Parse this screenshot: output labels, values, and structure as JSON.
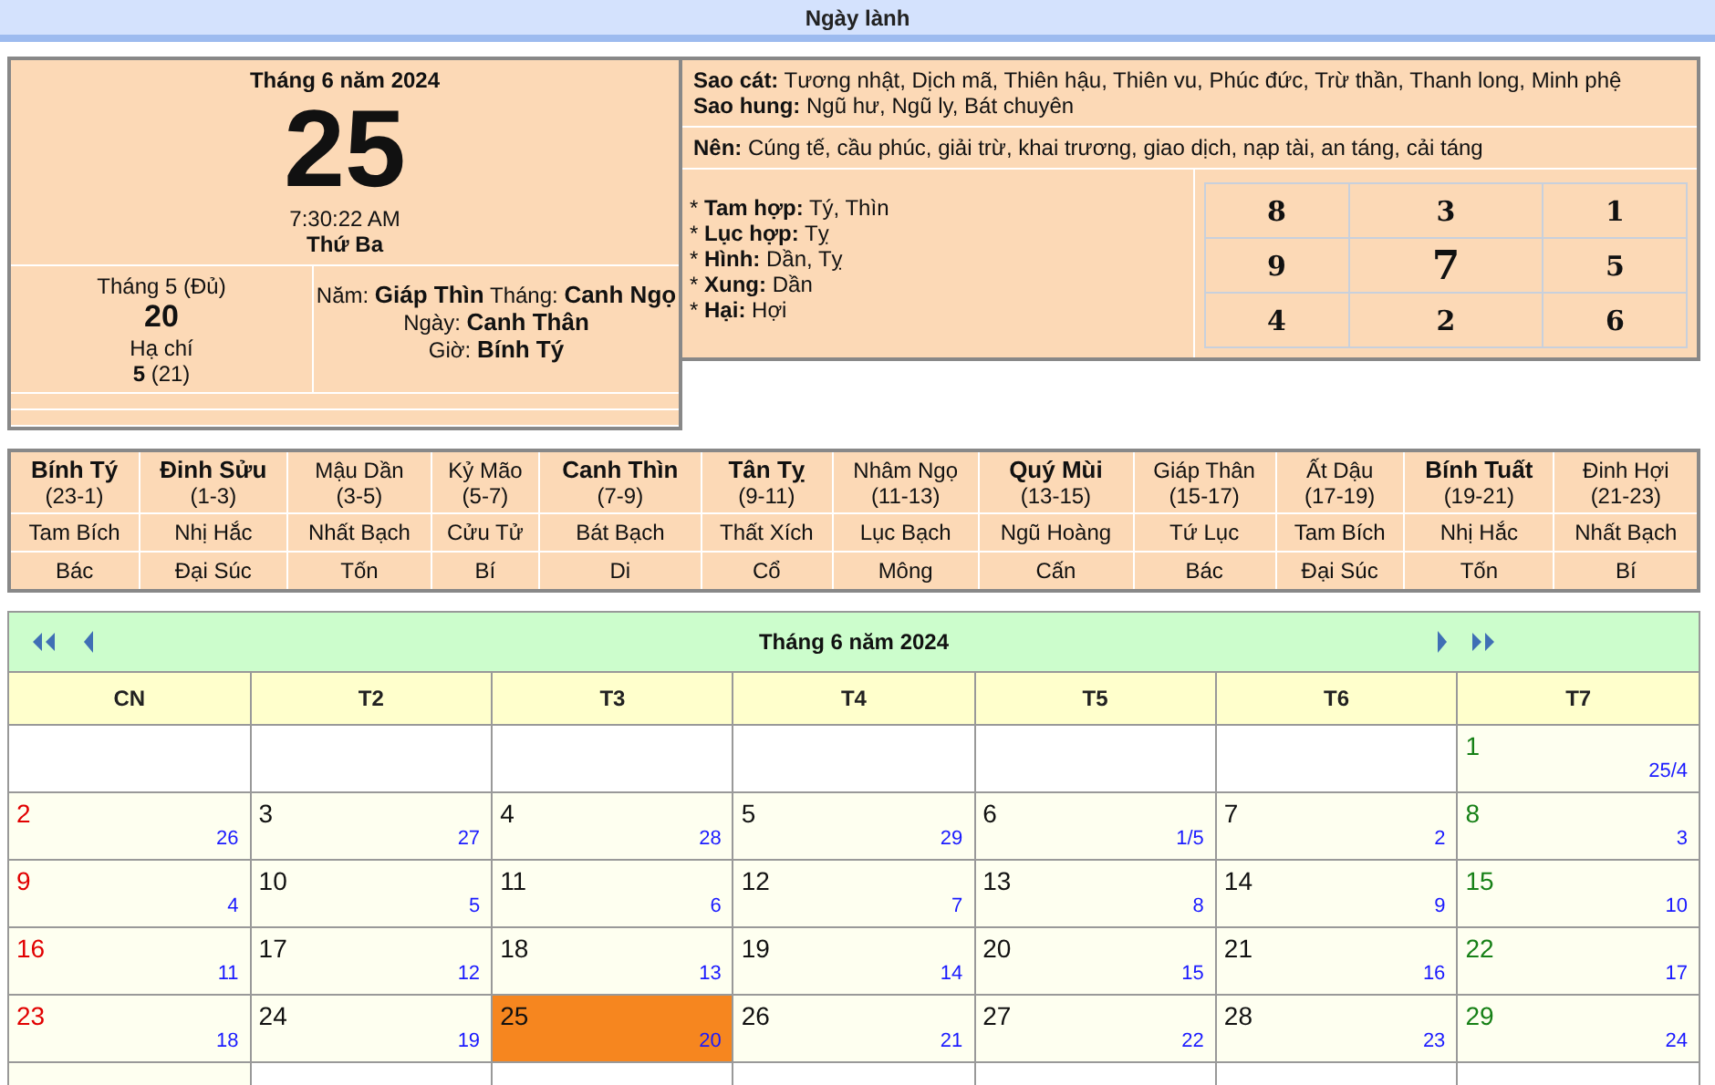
{
  "header": {
    "title": "Ngày lành"
  },
  "today": {
    "month_title": "Tháng 6 năm 2024",
    "day": "25",
    "time": "7:30:22 AM",
    "weekday": "Thứ Ba",
    "lunar": {
      "month": "Tháng 5 (Đủ)",
      "day": "20",
      "solar_term": "Hạ chí",
      "term_date": "**5** (21)"
    },
    "can_chi": [
      "Năm: **Giáp Thìn** Tháng: **Canh Ngọ**",
      "Ngày: **Canh Thân**",
      "Giờ: **Bính Tý**"
    ]
  },
  "info": {
    "stars": [
      "**Sao cát:** Tương nhật, Dịch mã, Thiên hậu, Thiên vu, Phúc đức, Trừ thần, Thanh long, Minh phệ",
      "**Sao hung:** Ngũ hư, Ngũ ly, Bát chuyên"
    ],
    "should": "**Nên:** Cúng tế, cầu phúc, giải trừ, khai trương, giao dịch, nạp tài, an táng, cải táng",
    "relations": [
      "* **Tam hợp:** Tý, Thìn",
      "* **Lục hợp:** Tỵ",
      "* **Hình:** Dần, Tỵ",
      "* **Xung:** Dần",
      "* **Hại:** Hợi"
    ],
    "grid": [
      [
        "8",
        "3",
        "1"
      ],
      [
        "9",
        "7",
        "5"
      ],
      [
        "4",
        "2",
        "6"
      ]
    ]
  },
  "hours": [
    {
      "name": "Bính Tý",
      "range": "(23-1)",
      "good": true,
      "star": "Tam Bích",
      "hexagram": "Bác"
    },
    {
      "name": "Đinh Sửu",
      "range": "(1-3)",
      "good": true,
      "star": "Nhị Hắc",
      "hexagram": "Đại Súc"
    },
    {
      "name": "Mậu Dần",
      "range": "(3-5)",
      "good": false,
      "star": "Nhất Bạch",
      "hexagram": "Tốn"
    },
    {
      "name": "Kỷ Mão",
      "range": "(5-7)",
      "good": false,
      "star": "Cửu Tử",
      "hexagram": "Bí"
    },
    {
      "name": "Canh Thìn",
      "range": "(7-9)",
      "good": true,
      "star": "Bát Bạch",
      "hexagram": "Di"
    },
    {
      "name": "Tân Tỵ",
      "range": "(9-11)",
      "good": true,
      "star": "Thất Xích",
      "hexagram": "Cổ"
    },
    {
      "name": "Nhâm Ngọ",
      "range": "(11-13)",
      "good": false,
      "star": "Lục Bạch",
      "hexagram": "Mông"
    },
    {
      "name": "Quý Mùi",
      "range": "(13-15)",
      "good": true,
      "star": "Ngũ Hoàng",
      "hexagram": "Cấn"
    },
    {
      "name": "Giáp Thân",
      "range": "(15-17)",
      "good": false,
      "star": "Tứ Lục",
      "hexagram": "Bác"
    },
    {
      "name": "Ất Dậu",
      "range": "(17-19)",
      "good": false,
      "star": "Tam Bích",
      "hexagram": "Đại Súc"
    },
    {
      "name": "Bính Tuất",
      "range": "(19-21)",
      "good": true,
      "star": "Nhị Hắc",
      "hexagram": "Tốn"
    },
    {
      "name": "Đinh Hợi",
      "range": "(21-23)",
      "good": false,
      "star": "Nhất Bạch",
      "hexagram": "Bí"
    }
  ],
  "calendar": {
    "title": "Tháng 6 năm 2024",
    "weekdays": [
      "CN",
      "T2",
      "T3",
      "T4",
      "T5",
      "T6",
      "T7"
    ],
    "weeks": [
      [
        {
          "kind": "blank"
        },
        {
          "kind": "blank"
        },
        {
          "kind": "blank"
        },
        {
          "kind": "blank"
        },
        {
          "kind": "blank"
        },
        {
          "kind": "blank"
        },
        {
          "kind": "day",
          "day": "1",
          "lunar": "25/4",
          "selected": false
        }
      ],
      [
        {
          "kind": "day",
          "day": "2",
          "lunar": "26",
          "selected": false
        },
        {
          "kind": "day",
          "day": "3",
          "lunar": "27",
          "selected": false
        },
        {
          "kind": "day",
          "day": "4",
          "lunar": "28",
          "selected": false
        },
        {
          "kind": "day",
          "day": "5",
          "lunar": "29",
          "selected": false
        },
        {
          "kind": "day",
          "day": "6",
          "lunar": "1/5",
          "selected": false
        },
        {
          "kind": "day",
          "day": "7",
          "lunar": "2",
          "selected": false
        },
        {
          "kind": "day",
          "day": "8",
          "lunar": "3",
          "selected": false
        }
      ],
      [
        {
          "kind": "day",
          "day": "9",
          "lunar": "4",
          "selected": false
        },
        {
          "kind": "day",
          "day": "10",
          "lunar": "5",
          "selected": false
        },
        {
          "kind": "day",
          "day": "11",
          "lunar": "6",
          "selected": false
        },
        {
          "kind": "day",
          "day": "12",
          "lunar": "7",
          "selected": false
        },
        {
          "kind": "day",
          "day": "13",
          "lunar": "8",
          "selected": false
        },
        {
          "kind": "day",
          "day": "14",
          "lunar": "9",
          "selected": false
        },
        {
          "kind": "day",
          "day": "15",
          "lunar": "10",
          "selected": false
        }
      ],
      [
        {
          "kind": "day",
          "day": "16",
          "lunar": "11",
          "selected": false
        },
        {
          "kind": "day",
          "day": "17",
          "lunar": "12",
          "selected": false
        },
        {
          "kind": "day",
          "day": "18",
          "lunar": "13",
          "selected": false
        },
        {
          "kind": "day",
          "day": "19",
          "lunar": "14",
          "selected": false
        },
        {
          "kind": "day",
          "day": "20",
          "lunar": "15",
          "selected": false
        },
        {
          "kind": "day",
          "day": "21",
          "lunar": "16",
          "selected": false
        },
        {
          "kind": "day",
          "day": "22",
          "lunar": "17",
          "selected": false
        }
      ],
      [
        {
          "kind": "day",
          "day": "23",
          "lunar": "18",
          "selected": false
        },
        {
          "kind": "day",
          "day": "24",
          "lunar": "19",
          "selected": false
        },
        {
          "kind": "day",
          "day": "25",
          "lunar": "20",
          "selected": true
        },
        {
          "kind": "day",
          "day": "26",
          "lunar": "21",
          "selected": false
        },
        {
          "kind": "day",
          "day": "27",
          "lunar": "22",
          "selected": false
        },
        {
          "kind": "day",
          "day": "28",
          "lunar": "23",
          "selected": false
        },
        {
          "kind": "day",
          "day": "29",
          "lunar": "24",
          "selected": false
        }
      ],
      [
        {
          "kind": "day",
          "selected": false
        },
        {
          "kind": "blank"
        },
        {
          "kind": "blank"
        },
        {
          "kind": "blank"
        },
        {
          "kind": "blank"
        },
        {
          "kind": "blank"
        },
        {
          "kind": "blank"
        }
      ]
    ]
  }
}
